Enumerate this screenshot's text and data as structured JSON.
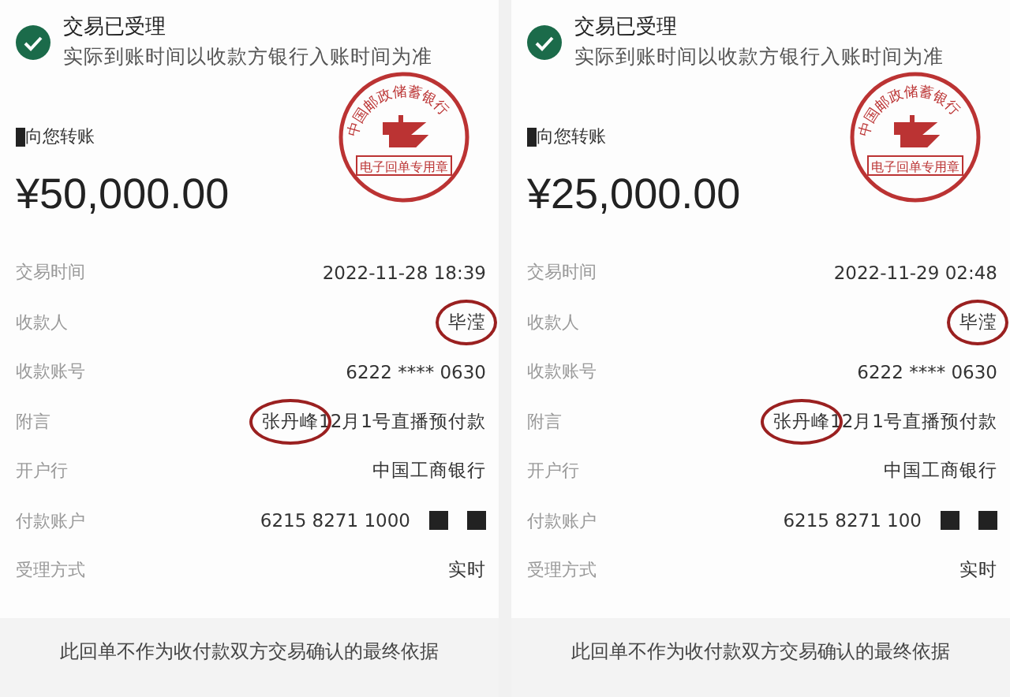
{
  "receipts": [
    {
      "status": {
        "title": "交易已受理",
        "subtitle": "实际到账时间以收款方银行入账时间为准",
        "done": true
      },
      "stamp": {
        "ring_text": "中国邮政储蓄银行",
        "band_text": "电子回单专用章"
      },
      "sender": {
        "text": "向您转账",
        "masked": true
      },
      "amount": "¥50,000.00",
      "rows": [
        {
          "label": "交易时间",
          "value": "2022-11-28 18:39"
        },
        {
          "label": "收款人",
          "value": "毕滢",
          "circled": true,
          "partial": false
        },
        {
          "label": "收款账号",
          "value": "6222 **** 0630"
        },
        {
          "label": "附言",
          "value": "张丹峰12月1号直播预付款",
          "circled": true,
          "partial": true
        },
        {
          "label": "开户行",
          "value": "中国工商银行"
        },
        {
          "label": "付款账户",
          "value": "6215 8271 1000",
          "masked": true
        },
        {
          "label": "受理方式",
          "value": "实时"
        }
      ],
      "footer": "此回单不作为收付款双方交易确认的最终依据"
    },
    {
      "status": {
        "title": "交易已受理",
        "subtitle": "实际到账时间以收款方银行入账时间为准",
        "done": true
      },
      "stamp": {
        "ring_text": "中国邮政储蓄银行",
        "band_text": "电子回单专用章"
      },
      "sender": {
        "text": "向您转账",
        "masked": true
      },
      "amount": "¥25,000.00",
      "rows": [
        {
          "label": "交易时间",
          "value": "2022-11-29 02:48"
        },
        {
          "label": "收款人",
          "value": "毕滢",
          "circled": true,
          "partial": false
        },
        {
          "label": "收款账号",
          "value": "6222 **** 0630"
        },
        {
          "label": "附言",
          "value": "张丹峰12月1号直播预付款",
          "circled": true,
          "partial": true
        },
        {
          "label": "开户行",
          "value": "中国工商银行"
        },
        {
          "label": "付款账户",
          "value": "6215 8271 100",
          "masked": true
        },
        {
          "label": "受理方式",
          "value": "实时"
        }
      ],
      "footer": "此回单不作为收付款双方交易确认的最终依据"
    }
  ]
}
